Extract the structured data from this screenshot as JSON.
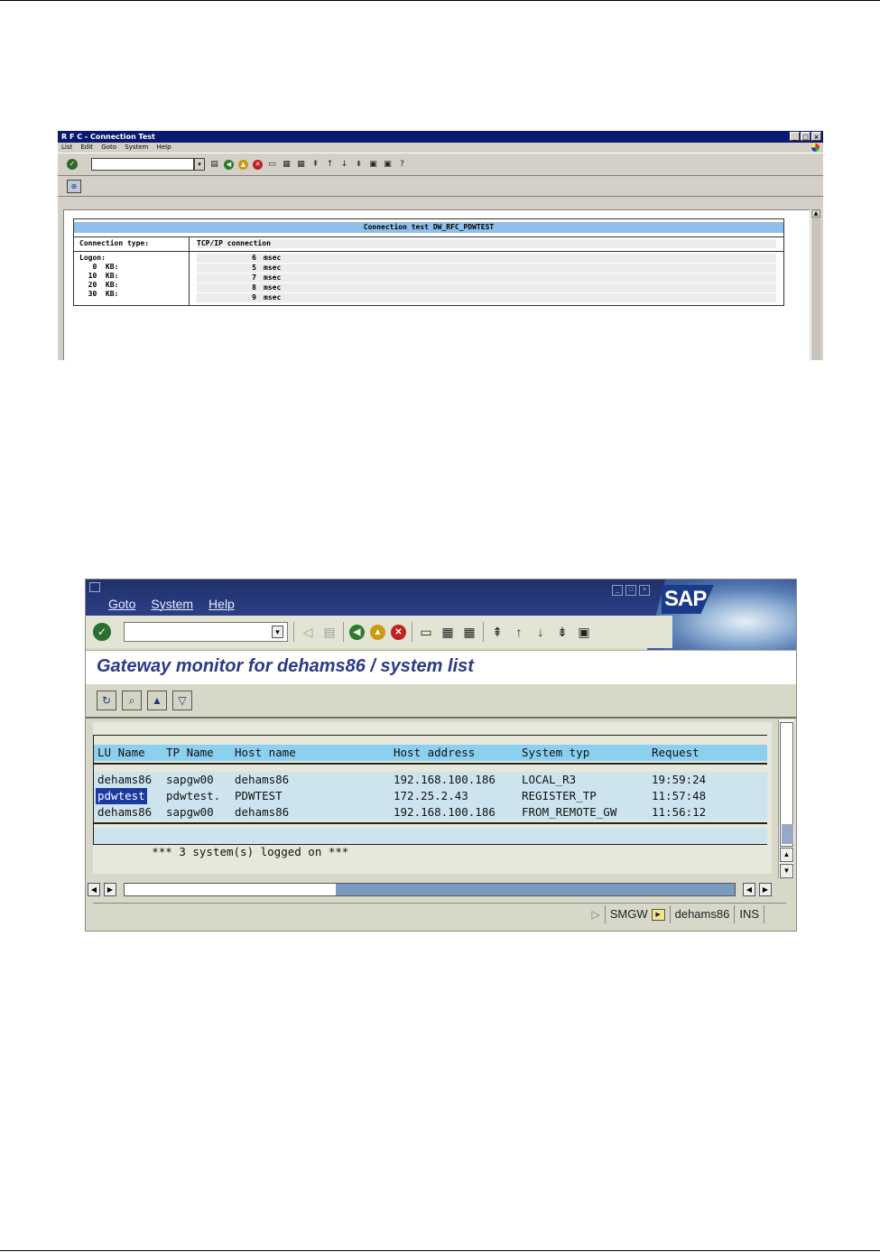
{
  "rfc_window": {
    "title": "R F C - Connection Test",
    "menu": [
      "List",
      "Edit",
      "Goto",
      "System",
      "Help"
    ],
    "report": {
      "header": "Connection test DW_RFC_PDWTEST",
      "connection_type_label": "Connection type:",
      "connection_type_value": "TCP/IP connection",
      "rows": [
        {
          "label": "Logon:",
          "value": "6",
          "unit": "msec"
        },
        {
          "label": "   0  KB:",
          "value": "5",
          "unit": "msec"
        },
        {
          "label": "  10  KB:",
          "value": "7",
          "unit": "msec"
        },
        {
          "label": "  20  KB:",
          "value": "8",
          "unit": "msec"
        },
        {
          "label": "  30  KB:",
          "value": "9",
          "unit": "msec"
        }
      ]
    }
  },
  "gateway_window": {
    "menu": [
      "Goto",
      "System",
      "Help"
    ],
    "logo": "SAP",
    "title": "Gateway monitor for dehams86 / system list",
    "columns": [
      "LU Name",
      "TP Name",
      "Host name",
      "Host address",
      "System typ",
      "Request"
    ],
    "rows": [
      {
        "lu": "dehams86",
        "tp": "sapgw00",
        "host": "dehams86",
        "addr": "192.168.100.186",
        "type": "LOCAL_R3",
        "req": "19:59:24"
      },
      {
        "lu": "pdwtest",
        "tp": "pdwtest.",
        "host": "PDWTEST",
        "addr": "172.25.2.43",
        "type": "REGISTER_TP",
        "req": "11:57:48"
      },
      {
        "lu": "dehams86",
        "tp": "sapgw00",
        "host": "dehams86",
        "addr": "192.168.100.186",
        "type": "FROM_REMOTE_GW",
        "req": "11:56:12"
      }
    ],
    "footer": "*** 3 system(s) logged on ***",
    "status": {
      "transaction": "SMGW",
      "server": "dehams86",
      "mode": "INS"
    },
    "colors": {
      "header_row": "#8cd0f0",
      "data_row": "#cde4ee",
      "selection": "#1a3aa0",
      "title": "#2a3a8a"
    }
  }
}
